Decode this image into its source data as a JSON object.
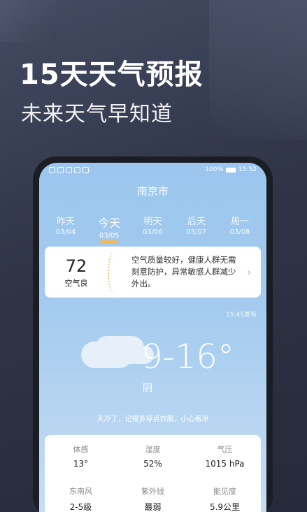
{
  "promo": {
    "title": "15天天气预报",
    "subtitle": "未来天气早知道"
  },
  "status_bar": {
    "battery": "100%",
    "time": "15:52"
  },
  "city": "南京市",
  "days": [
    {
      "name": "昨天",
      "date": "03/04"
    },
    {
      "name": "今天",
      "date": "03/05"
    },
    {
      "name": "明天",
      "date": "03/06"
    },
    {
      "name": "后天",
      "date": "03/07"
    },
    {
      "name": "周一",
      "date": "03/08"
    }
  ],
  "aqi": {
    "value": "72",
    "label": "空气良",
    "description": "空气质量较好，健康人群无需刻意防护，异常敏感人群减少外出。"
  },
  "publish_time": "15:45发布",
  "weather": {
    "temp": "9-16°",
    "condition": "阴",
    "tip": "天冷了，记得多穿点衣服，小心着凉"
  },
  "details": [
    {
      "label": "体感",
      "value": "13°"
    },
    {
      "label": "湿度",
      "value": "52%"
    },
    {
      "label": "气压",
      "value": "1015 hPa"
    },
    {
      "label": "东南风",
      "value": "2-5级"
    },
    {
      "label": "紫外线",
      "value": "最弱"
    },
    {
      "label": "能见度",
      "value": "5.9公里"
    }
  ],
  "colors": {
    "background": "#2f3447",
    "screen_top": "#9cc6ee",
    "accent": "#f0b860"
  }
}
